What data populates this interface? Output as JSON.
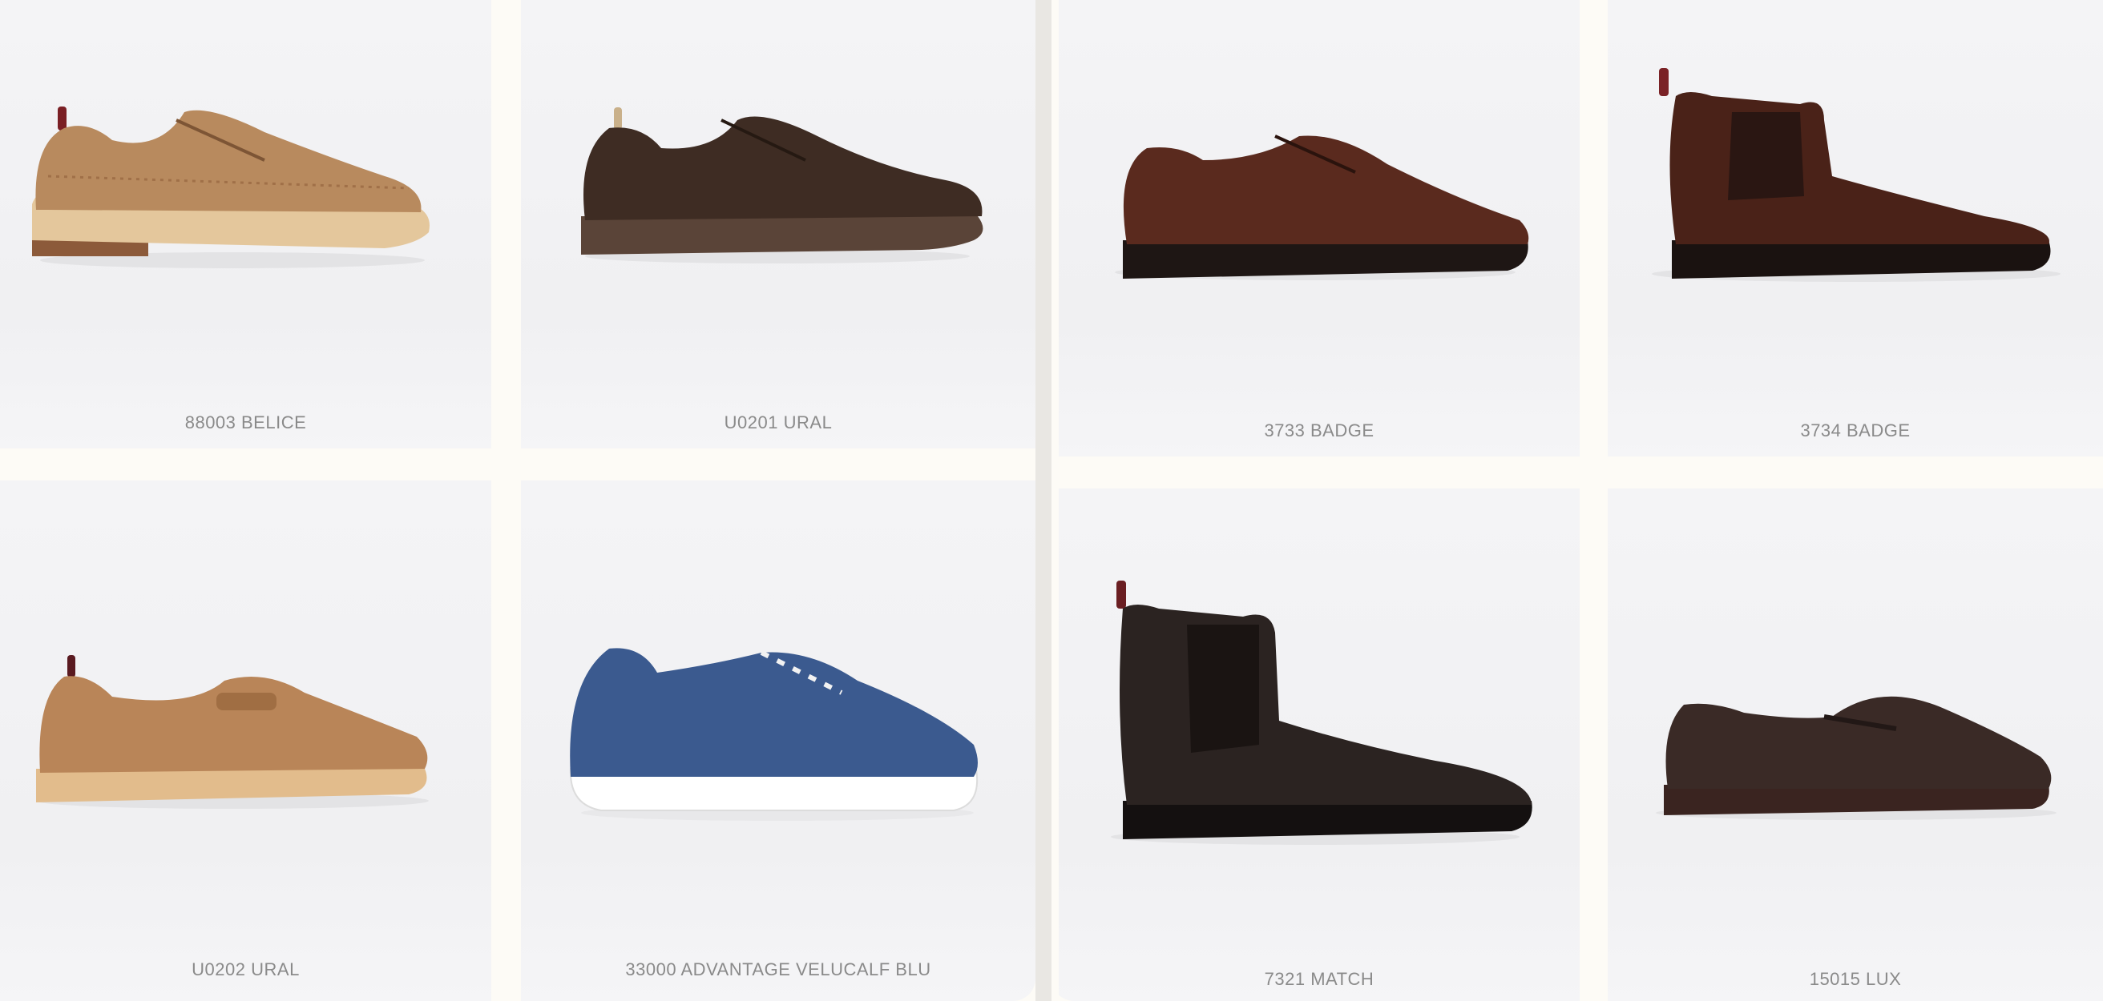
{
  "products": [
    {
      "name": "88003 BELICE",
      "shoe": "suede-wingtip-derby",
      "color": "#b88a5e"
    },
    {
      "name": "U0201 URAL",
      "shoe": "suede-derby",
      "color": "#3e2c23"
    },
    {
      "name": "3733 BADGE",
      "shoe": "leather-derby",
      "color": "#5a2a1e"
    },
    {
      "name": "3734 BADGE",
      "shoe": "chelsea-boot",
      "color": "#4a2218"
    },
    {
      "name": "U0202 URAL",
      "shoe": "suede-penny-loafer",
      "color": "#b98558"
    },
    {
      "name": "33000 ADVANTAGE VELUCALF BLU",
      "shoe": "suede-sneaker",
      "color": "#3b5a8f"
    },
    {
      "name": "7321 MATCH",
      "shoe": "chelsea-boot",
      "color": "#2b2321"
    },
    {
      "name": "15015 LUX",
      "shoe": "penny-loafer",
      "color": "#3a2a26"
    }
  ]
}
